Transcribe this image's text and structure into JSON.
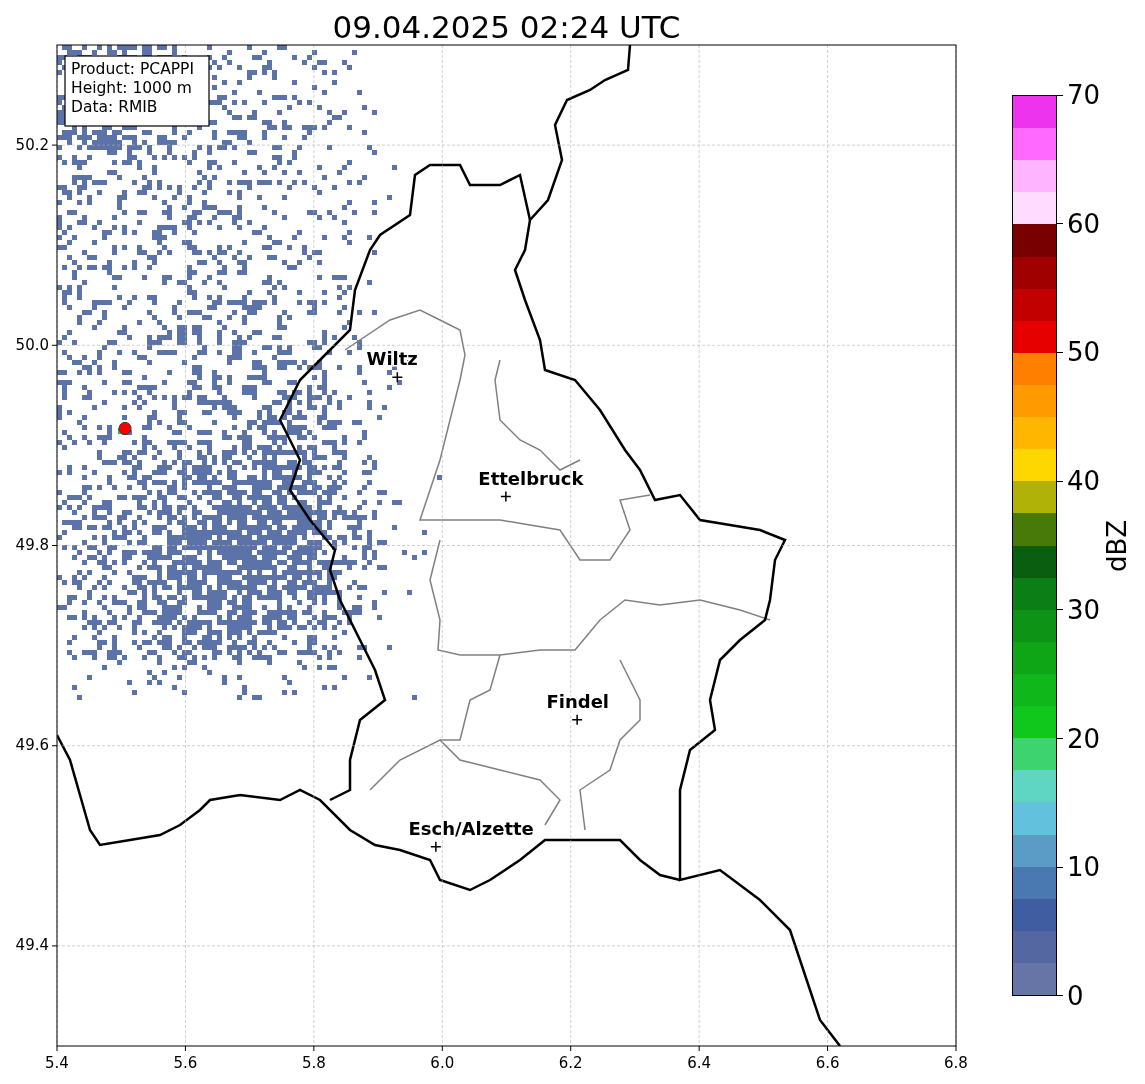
{
  "title": "09.04.2025 02:24 UTC",
  "info_box": {
    "lines": [
      "Product: PCAPPI",
      "Height: 1000 m",
      "Data: RMIB"
    ]
  },
  "map": {
    "x_tick_labels": [
      "5.4",
      "5.6",
      "5.8",
      "6.0",
      "6.2",
      "6.4",
      "6.6",
      "6.8"
    ],
    "y_tick_labels": [
      "50.2",
      "50.0",
      "49.8",
      "49.6",
      "49.4"
    ],
    "places": [
      {
        "name": "Wiltz"
      },
      {
        "name": "Ettelbruck"
      },
      {
        "name": "Findel"
      },
      {
        "name": "Esch/Alzette"
      }
    ]
  },
  "colorbar": {
    "label": "dBZ",
    "ticks": [
      "70",
      "60",
      "50",
      "40",
      "30",
      "20",
      "10",
      "0"
    ],
    "bands": [
      {
        "color": "#ee33ee"
      },
      {
        "color": "#ff69ff"
      },
      {
        "color": "#ffb4ff"
      },
      {
        "color": "#ffdcff"
      },
      {
        "color": "#780000"
      },
      {
        "color": "#a00000"
      },
      {
        "color": "#c20000"
      },
      {
        "color": "#e60000"
      },
      {
        "color": "#ff7f00"
      },
      {
        "color": "#ff9b00"
      },
      {
        "color": "#ffb600"
      },
      {
        "color": "#ffd700"
      },
      {
        "color": "#b0b208"
      },
      {
        "color": "#487a0a"
      },
      {
        "color": "#0a5e0f"
      },
      {
        "color": "#0c7e16"
      },
      {
        "color": "#0d9416"
      },
      {
        "color": "#0ea516"
      },
      {
        "color": "#10b71a"
      },
      {
        "color": "#10c81c"
      },
      {
        "color": "#3dd46f"
      },
      {
        "color": "#5fd6c4"
      },
      {
        "color": "#62c1dc"
      },
      {
        "color": "#5a9cc5"
      },
      {
        "color": "#4a78b0"
      },
      {
        "color": "#415da2"
      },
      {
        "color": "#5467a0"
      },
      {
        "color": "#6774a6"
      }
    ]
  }
}
